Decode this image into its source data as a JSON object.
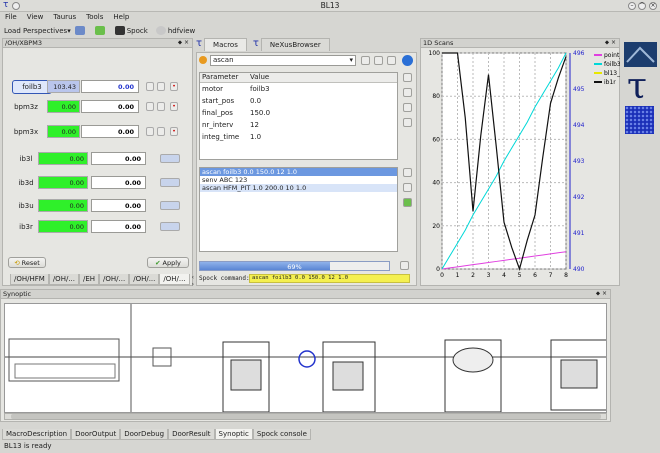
{
  "window": {
    "title": "BL13"
  },
  "menu": [
    "File",
    "View",
    "Taurus",
    "Tools",
    "Help"
  ],
  "toolbar": {
    "perspectives": "Load Perspectives",
    "spock": "Spock",
    "hdfview": "hdfview"
  },
  "left_panel": {
    "title": "/OH/XBPM3",
    "rows": [
      {
        "label": "foilb3",
        "value": "103.43",
        "input": "0.00",
        "selected": true
      },
      {
        "label": "bpm3z",
        "value": "0.00",
        "input": "0.00"
      },
      {
        "label": "bpm3x",
        "value": "0.00",
        "input": "0.00"
      },
      {
        "label": "ib3l",
        "value": "0.00",
        "input": "0.00"
      },
      {
        "label": "ib3d",
        "value": "0.00",
        "input": "0.00"
      },
      {
        "label": "ib3u",
        "value": "0.00",
        "input": "0.00"
      },
      {
        "label": "ib3r",
        "value": "0.00",
        "input": "0.00"
      }
    ],
    "reset": "Reset",
    "apply": "Apply",
    "tabs": [
      "/OH/HFM",
      "/OH/...",
      "/EH",
      "/OH/...",
      "/OH/...",
      "/OH/..."
    ]
  },
  "macros": {
    "tabs": [
      "Macros",
      "NeXusBrowser"
    ],
    "selected_macro": "ascan",
    "param_headers": [
      "Parameter",
      "Value"
    ],
    "params": [
      [
        "motor",
        "foilb3"
      ],
      [
        "start_pos",
        "0.0"
      ],
      [
        "final_pos",
        "150.0"
      ],
      [
        "nr_interv",
        "12"
      ],
      [
        "integ_time",
        "1.0"
      ]
    ],
    "sequence": [
      "ascan foilb3 0.0 150.0 12 1.0",
      "senv ABC 123",
      "ascan HFM_PIT 1.0 200.0 10 1.0"
    ],
    "progress_pct": 69,
    "progress_label": "69%",
    "spock_label": "Spock command:",
    "spock_command": "ascan foilb3 0.0 150.0 12 1.0"
  },
  "scans": {
    "title": "1D Scans",
    "legend": [
      "point_nb",
      "foilb3",
      "bl13_uxtimer",
      "ib1r"
    ],
    "colors": {
      "point_nb": "#e040e0",
      "foilb3": "#00d8d8",
      "bl13_uxtimer": "#e8e800",
      "ib1r": "#111111"
    }
  },
  "chart_data": {
    "type": "line",
    "x": [
      0,
      0.5,
      1,
      1.5,
      2,
      2.5,
      3,
      3.5,
      4,
      4.5,
      5,
      5.5,
      6,
      6.5,
      7,
      7.5,
      8
    ],
    "series": [
      {
        "name": "point_nb",
        "axis": "left",
        "values": [
          0,
          0.5,
          1,
          1.5,
          2,
          2.5,
          3,
          3.5,
          4,
          4.5,
          5,
          5.5,
          6,
          6.5,
          7,
          7.5,
          8
        ]
      },
      {
        "name": "foilb3",
        "axis": "left",
        "values": [
          0,
          6,
          12,
          18,
          25,
          31,
          37,
          43,
          50,
          56,
          62,
          68,
          75,
          81,
          87,
          93,
          100
        ]
      },
      {
        "name": "ib1r",
        "axis": "right",
        "values": [
          496,
          496,
          496,
          494.2,
          491.6,
          493.7,
          495.4,
          493.4,
          491.3,
          490.6,
          490,
          490.8,
          491.5,
          493.1,
          494.6,
          495.3,
          495.9
        ]
      }
    ],
    "ylim": [
      0,
      100
    ],
    "y2lim": [
      490,
      496
    ],
    "xlim": [
      0,
      8
    ],
    "xticks": [
      0,
      1,
      2,
      3,
      4,
      5,
      6,
      7,
      8
    ],
    "yticks": [
      0,
      20,
      40,
      60,
      80,
      100
    ],
    "y2ticks": [
      490,
      491,
      492,
      493,
      494,
      495,
      496
    ]
  },
  "synoptic": {
    "title": "Synoptic"
  },
  "bottom_tabs": [
    "MacroDescription",
    "DoorOutput",
    "DoorDebug",
    "DoorResult",
    "Synoptic",
    "Spock console"
  ],
  "status": "BL13 is ready"
}
